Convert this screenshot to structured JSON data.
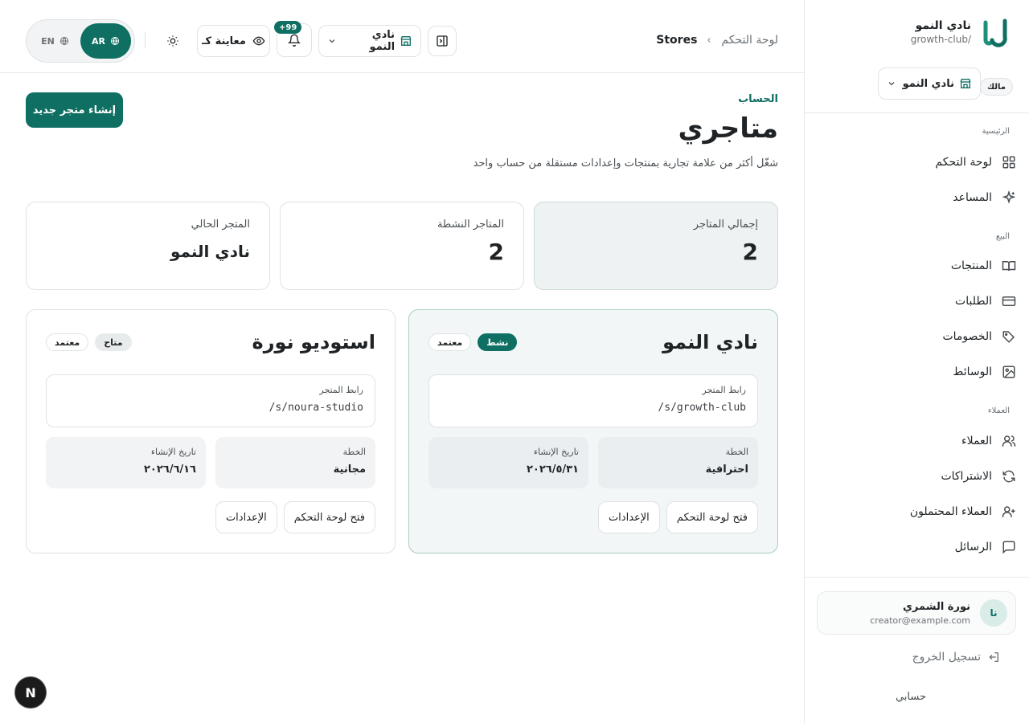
{
  "brand": {
    "name": "نادي النمو",
    "slug": "growth-club/"
  },
  "sidebar": {
    "store_switch": "نادي النمو",
    "owner_badge": "مالك",
    "sections": {
      "main": "الرئيسية",
      "sales": "البيع",
      "customers": "العملاء"
    },
    "items": {
      "dashboard": "لوحة التحكم",
      "assistant": "المساعد",
      "products": "المنتجات",
      "orders": "الطلبات",
      "discounts": "الخصومات",
      "media": "الوسائط",
      "clients": "العملاء",
      "subscriptions": "الاشتراكات",
      "leads": "العملاء المحتملون",
      "messages": "الرسائل"
    },
    "user": {
      "initials": "نا",
      "name": "نورة الشمري",
      "email": "creator@example.com"
    },
    "logout": "تسجيل الخروج",
    "my_account": "حسابي"
  },
  "topbar": {
    "breadcrumb_root": "لوحة التحكم",
    "breadcrumb_current": "Stores",
    "store_select": "نادي النمو",
    "notif_count": "+99",
    "preview_label": "معاينة كـ",
    "lang": {
      "ar": "AR",
      "en": "EN"
    }
  },
  "page": {
    "eyebrow": "الحساب",
    "title": "متاجري",
    "subtitle": "شغّل أكثر من علامة تجارية بمنتجات وإعدادات مستقلة من حساب واحد",
    "create_button": "إنشاء متجر جديد"
  },
  "stats": [
    {
      "label": "إجمالي المتاجر",
      "value": "2"
    },
    {
      "label": "المتاجر النشطة",
      "value": "2"
    },
    {
      "label": "المتجر الحالي",
      "value": "نادي النمو"
    }
  ],
  "stores": [
    {
      "name": "نادي النمو",
      "status_badge": "نشط",
      "approval_badge": "معتمد",
      "link_label": "رابط المتجر",
      "link": "/s/growth-club",
      "plan_label": "الخطة",
      "plan": "احترافية",
      "created_label": "تاريخ الإنشاء",
      "created": "٢٠٢٦/٥/٣١",
      "open_button": "فتح لوحة التحكم",
      "settings_button": "الإعدادات"
    },
    {
      "name": "استوديو نورة",
      "status_badge": "متاح",
      "approval_badge": "معتمد",
      "link_label": "رابط المتجر",
      "link": "/s/noura-studio",
      "plan_label": "الخطة",
      "plan": "مجانية",
      "created_label": "تاريخ الإنشاء",
      "created": "٢٠٢٦/٦/١٦",
      "open_button": "فتح لوحة التحكم",
      "settings_button": "الإعدادات"
    }
  ],
  "dev_badge": "N",
  "colors": {
    "accent": "#0f6f62",
    "border": "#dfe2e4",
    "muted": "#6b7176"
  }
}
